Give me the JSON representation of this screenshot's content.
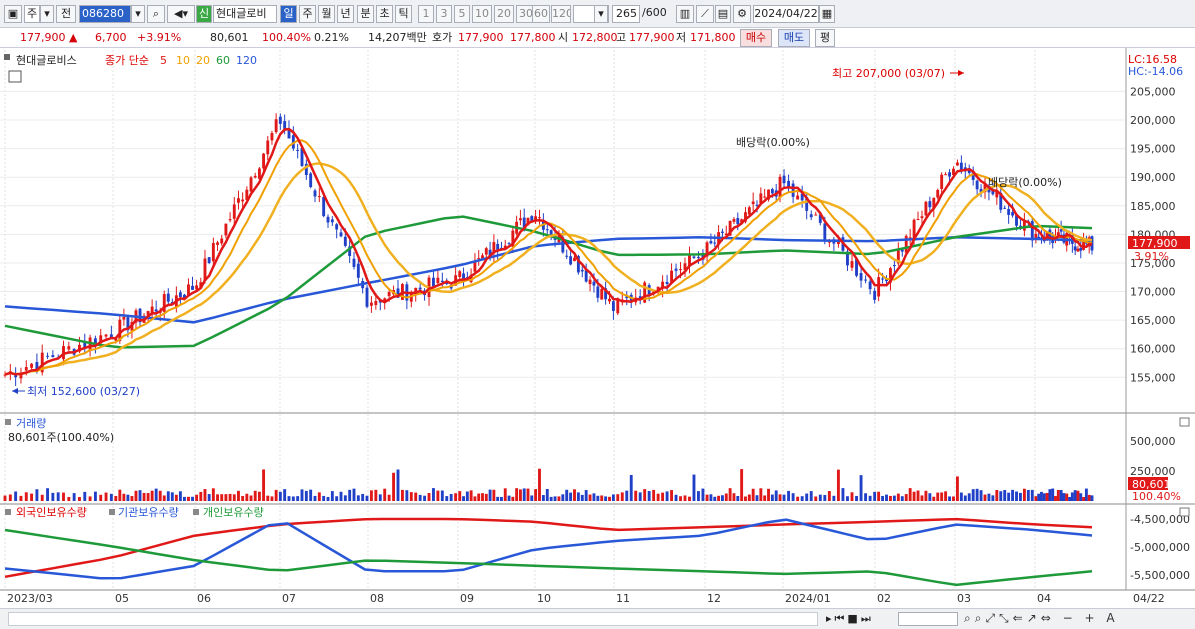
{
  "toolbar": {
    "period_current": "주",
    "period_prev": "전",
    "code": "086280",
    "new_badge": "신",
    "stock_name": "현대글로비",
    "intervals": [
      "일",
      "주",
      "월",
      "년",
      "분",
      "초",
      "틱"
    ],
    "minutes": [
      "1",
      "3",
      "5",
      "10",
      "20",
      "30",
      "60",
      "120"
    ],
    "count": "265",
    "count_total": "/600",
    "date": "2024/04/22"
  },
  "quote": {
    "price": "177,900 ▲",
    "change": "6,700",
    "change_pct": "+3.91%",
    "volume": "80,601",
    "vol_ratio": "100.40%",
    "turnover": "0.21%",
    "amount": "14,207백만",
    "ask_label": "호가",
    "ask": "177,900",
    "bid": "177,800",
    "open_label": "시",
    "open": "172,800",
    "high_label": "고",
    "high": "177,900",
    "low_label": "저",
    "low": "171,800",
    "buy": "매수",
    "sell": "매도",
    "flat": "평"
  },
  "price_panel": {
    "name": "현대글로비스",
    "ma_label": "종가 단순",
    "ma_periods": [
      "5",
      "10",
      "20",
      "60",
      "120"
    ],
    "lc": "LC:16.58",
    "hc": "HC:-14.06",
    "high_note": "최고 207,000 (03/07)",
    "low_note": "최저 152,600 (03/27)",
    "div1": "배당락(0.00%)",
    "div2": "배당락(0.00%)",
    "last_price_tag": "177,900",
    "last_pct_tag": "3.91%",
    "y_ticks": [
      "205,000",
      "200,000",
      "195,000",
      "190,000",
      "185,000",
      "180,000",
      "175,000",
      "170,000",
      "165,000",
      "160,000",
      "155,000"
    ]
  },
  "volume_panel": {
    "title": "거래량",
    "value": "80,601주(100.40%)",
    "y_ticks": [
      "500,000",
      "250,000"
    ],
    "tag": "80,601",
    "tag_pct": "100.40%"
  },
  "holders_panel": {
    "legend": [
      "외국인보유수량",
      "기관보유수량",
      "개인보유수량"
    ],
    "y_ticks": [
      "-4,500,000",
      "-5,000,000",
      "-5,500,000"
    ]
  },
  "x_ticks": [
    "2023/03",
    "05",
    "06",
    "07",
    "08",
    "09",
    "10",
    "11",
    "12",
    "2024/01",
    "02",
    "03",
    "04"
  ],
  "x_end": "04/22",
  "colors": {
    "ma5": "#e01818",
    "ma10": "#f0a000",
    "ma20": "#f0a000",
    "ma60": "#1e9a3a",
    "ma120": "#2858d8",
    "up": "#e01818",
    "down": "#2040c8"
  },
  "chart_data": {
    "type": "line",
    "title": "현대글로비스",
    "x": [
      "2023/03",
      "05",
      "06",
      "07",
      "08",
      "09",
      "10",
      "11",
      "12",
      "2024/01",
      "02",
      "03",
      "04",
      "04/22"
    ],
    "series": [
      {
        "name": "종가",
        "values": [
          155500,
          163000,
          171000,
          200000,
          168500,
          172000,
          184000,
          167000,
          177000,
          189000,
          170000,
          193000,
          180000,
          177900
        ]
      },
      {
        "name": "120",
        "values": [
          167400,
          166000,
          164600,
          168500,
          171500,
          174500,
          178000,
          179200,
          179500,
          179000,
          178800,
          179500,
          179200,
          178900
        ]
      },
      {
        "name": "60",
        "values": [
          164000,
          160200,
          160500,
          168000,
          180000,
          183300,
          180500,
          176400,
          176500,
          177200,
          176500,
          179500,
          181500,
          181100
        ]
      }
    ],
    "ylim": [
      150000,
      208000
    ]
  }
}
